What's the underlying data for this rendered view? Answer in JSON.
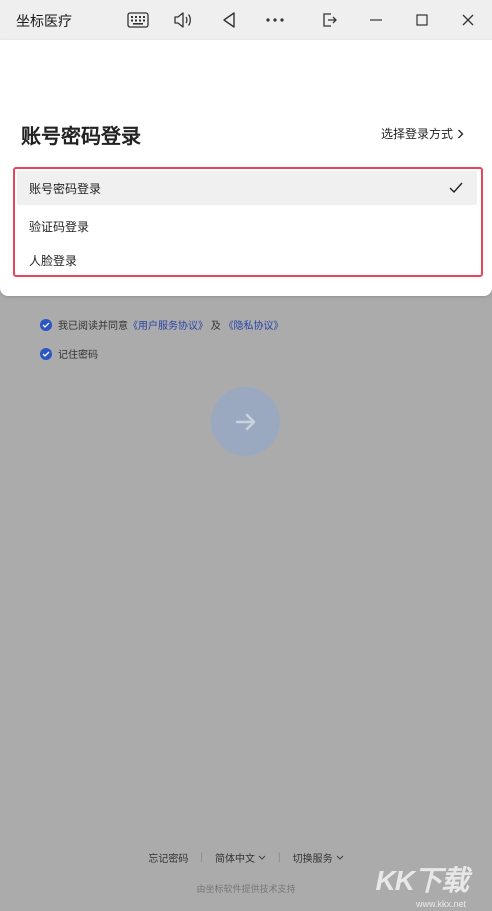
{
  "window": {
    "title": "坐标医疗",
    "controls": [
      "keyboard-icon",
      "speaker-icon",
      "back-icon",
      "more-icon",
      "cast-icon",
      "minimize-icon",
      "maximize-icon",
      "close-icon"
    ]
  },
  "login": {
    "heading": "账号密码登录",
    "select_method_label": "选择登录方式",
    "methods": [
      {
        "label": "账号密码登录",
        "selected": true
      },
      {
        "label": "验证码登录",
        "selected": false
      },
      {
        "label": "人脸登录",
        "selected": false
      }
    ]
  },
  "agreement": {
    "prefix": "我已阅读并同意",
    "user_agreement": "《用户服务协议》",
    "conjunction": "及",
    "privacy_policy": "《隐私协议》",
    "checked": true
  },
  "remember": {
    "label": "记住密码",
    "checked": true
  },
  "footer": {
    "forgot_password": "忘记密码",
    "language": "简体中文",
    "switch_service": "切换服务",
    "note": "由坐标软件提供技术支持"
  },
  "watermark": {
    "brand": "KK下载",
    "url": "www.kkx.net"
  },
  "colors": {
    "accent_blue": "#2a56c4",
    "highlight_red": "#e8475b",
    "overlay_grey": "#ababab"
  }
}
